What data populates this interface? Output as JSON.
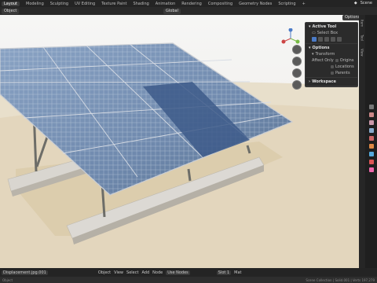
{
  "topbar": {
    "workspaces": [
      "Layout",
      "Modeling",
      "Sculpting",
      "UV Editing",
      "Texture Paint",
      "Shading",
      "Animation",
      "Rendering",
      "Compositing",
      "Geometry Nodes",
      "Scripting"
    ],
    "active": "Layout",
    "add": "+",
    "scene": "Scene"
  },
  "header": {
    "object_mode": "Object",
    "transform": "Global"
  },
  "options_tab": "Options",
  "npanel": {
    "active_tool": "Active Tool",
    "select_box": "Select Box",
    "options": "Options",
    "transform": "Transform",
    "affect_only": "Affect Only",
    "origins": "Origins",
    "locations": "Locations",
    "parents": "Parents",
    "workspace": "Workspace"
  },
  "side_tabs": [
    "Item",
    "Tool",
    "View"
  ],
  "bottombar": {
    "mat": "Displacement.jpg.001",
    "object": "Object",
    "view": "View",
    "select": "Select",
    "add": "Add",
    "node": "Node",
    "use_nodes": "Use Nodes",
    "slot": "Slot 1",
    "mat2": "Mat"
  },
  "status": {
    "left": "Object",
    "right": "Scene Collection | Solid.001 | Verts 197,279"
  },
  "colors": {
    "accent": "#4b7bc7",
    "sand": "#e7ddc8",
    "panel_blue": "#3d5a8a"
  }
}
